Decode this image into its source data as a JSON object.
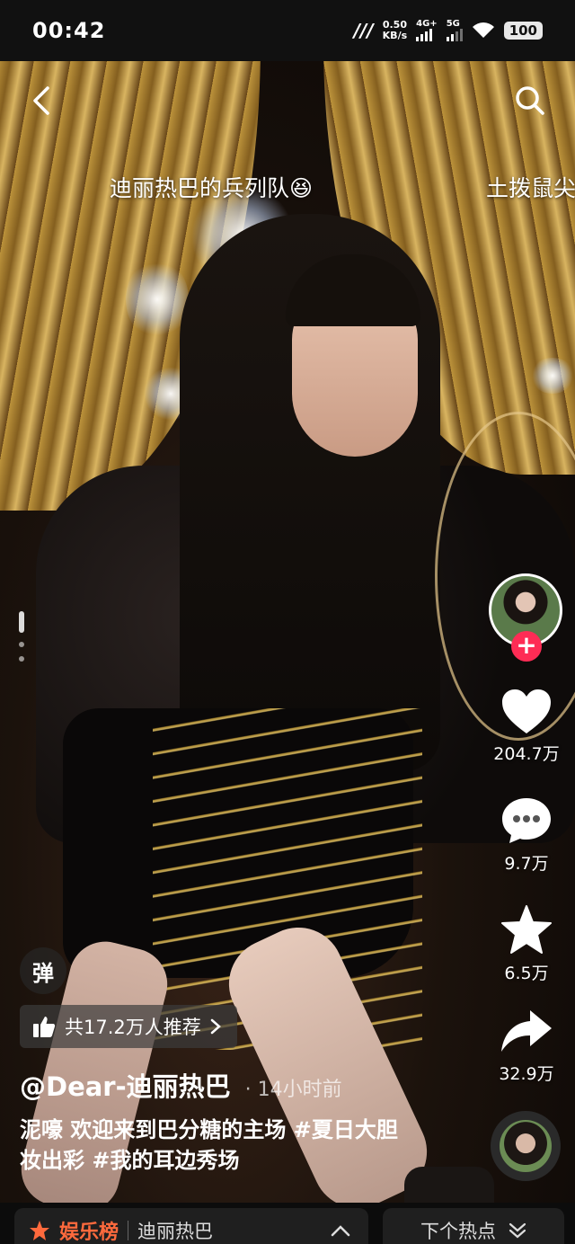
{
  "status_bar": {
    "time": "00:42",
    "net_speed_value": "0.50",
    "net_speed_unit": "KB/s",
    "signal1_label": "4G+",
    "signal2_label": "5G",
    "battery": "100"
  },
  "danmaku": [
    {
      "text": "迪丽热巴的兵列队😆"
    },
    {
      "text": "土拨鼠尖"
    }
  ],
  "actions": {
    "follow_symbol": "+",
    "likes": "204.7万",
    "comments": "9.7万",
    "favorites": "6.5万",
    "shares": "32.9万"
  },
  "info": {
    "danmu_toggle": "弹",
    "recommend_text": "共17.2万人推荐",
    "author": "@Dear-迪丽热巴",
    "time_ago": "· 14小时前",
    "caption": "泥嚎 欢迎来到巴分糖的主场 #夏日大胆妆出彩 #我的耳边秀场"
  },
  "bottom_bar": {
    "rank_title": "娱乐榜",
    "rank_topic": "迪丽热巴",
    "next_label": "下个热点"
  },
  "colors": {
    "follow_red": "#fe2c55",
    "rank_orange": "#ff6a3d"
  }
}
